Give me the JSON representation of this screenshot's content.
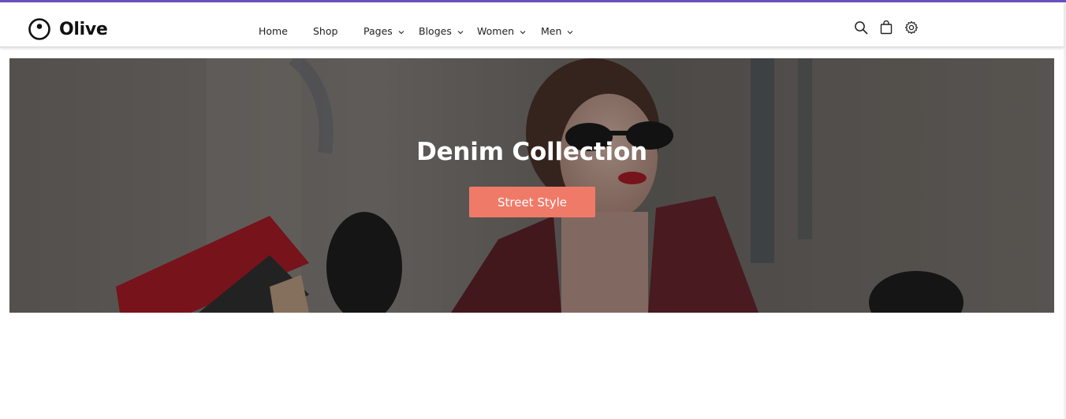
{
  "brand": {
    "name": "Olive",
    "logo_icon": "eye-circle-logo"
  },
  "nav": {
    "items": [
      {
        "label": "Home",
        "has_dropdown": false
      },
      {
        "label": "Shop",
        "has_dropdown": false
      },
      {
        "label": "Pages",
        "has_dropdown": true
      },
      {
        "label": "Bloges",
        "has_dropdown": true
      },
      {
        "label": "Women",
        "has_dropdown": true
      },
      {
        "label": "Men",
        "has_dropdown": true
      }
    ]
  },
  "header_icons": [
    "search-icon",
    "shopping-bag-icon",
    "settings-gear-icon"
  ],
  "hero": {
    "title": "Denim Collection",
    "cta_label": "Street Style"
  },
  "colors": {
    "accent_top_bar": "#6b4fbb",
    "cta_background": "#f07a68",
    "hero_text": "#ffffff",
    "nav_text": "#222222"
  }
}
